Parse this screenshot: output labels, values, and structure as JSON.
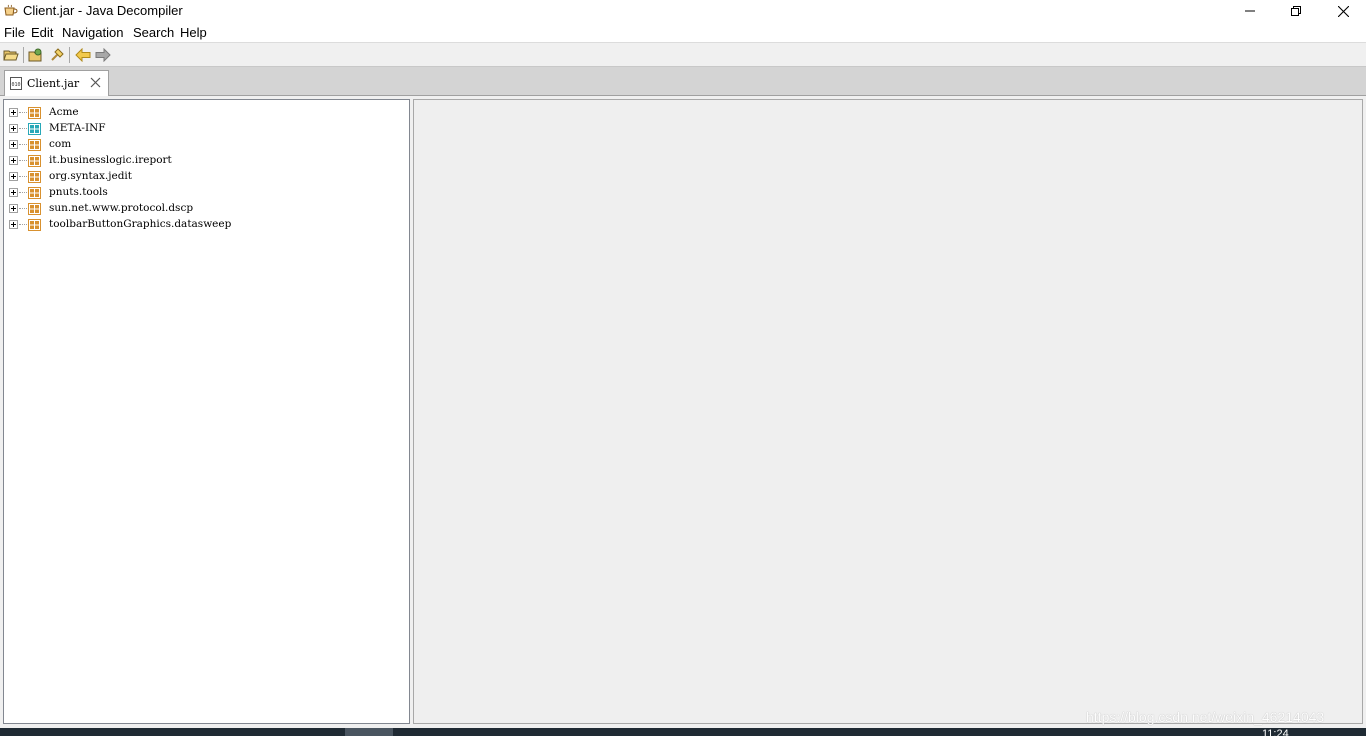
{
  "window": {
    "title": "Client.jar - Java Decompiler",
    "app_icon": "coffee-cup-icon"
  },
  "menubar": {
    "items": [
      "File",
      "Edit",
      "Navigation",
      "Search",
      "Help"
    ]
  },
  "toolbar": {
    "buttons": [
      "open-file-icon",
      "open-type-icon",
      "search-icon",
      "back-arrow-icon",
      "forward-arrow-icon"
    ]
  },
  "tabs": [
    {
      "label": "Client.jar",
      "icon": "jar-file-icon"
    }
  ],
  "tree": {
    "items": [
      {
        "label": "Acme",
        "icon": "package-icon",
        "color": "#d8912f"
      },
      {
        "label": "META-INF",
        "icon": "package-icon",
        "color": "#28a8b8"
      },
      {
        "label": "com",
        "icon": "package-icon",
        "color": "#d8912f"
      },
      {
        "label": "it.businesslogic.ireport",
        "icon": "package-icon",
        "color": "#d8912f"
      },
      {
        "label": "org.syntax.jedit",
        "icon": "package-icon",
        "color": "#d8912f"
      },
      {
        "label": "pnuts.tools",
        "icon": "package-icon",
        "color": "#d8912f"
      },
      {
        "label": "sun.net.www.protocol.dscp",
        "icon": "package-icon",
        "color": "#d8912f"
      },
      {
        "label": "toolbarButtonGraphics.datasweep",
        "icon": "package-icon",
        "color": "#d8912f"
      }
    ]
  },
  "taskbar": {
    "clock": "11:24"
  },
  "watermark": "https://blog.csdn.net/weixin_46214043"
}
